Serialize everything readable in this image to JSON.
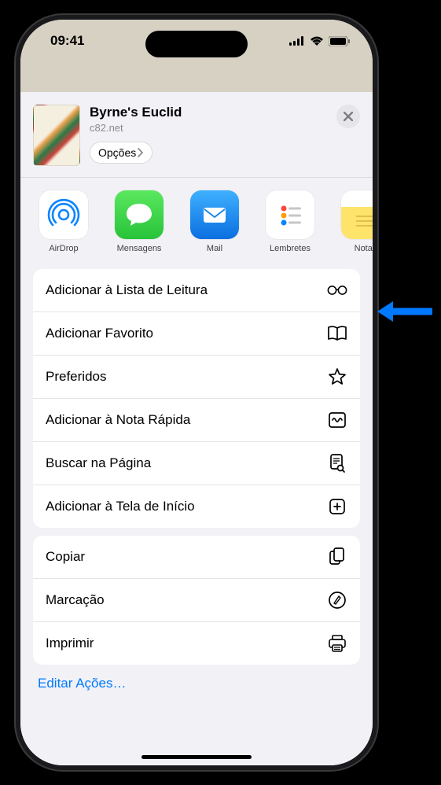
{
  "status": {
    "time": "09:41"
  },
  "header": {
    "title": "Byrne's Euclid",
    "subtitle": "c82.net",
    "options_label": "Opções"
  },
  "apps": [
    {
      "label": "AirDrop",
      "icon": "airdrop",
      "bg": "#ffffff",
      "fg": "#0a84ff"
    },
    {
      "label": "Mensagens",
      "icon": "messages",
      "bg": "#32d74b",
      "fg": "#ffffff"
    },
    {
      "label": "Mail",
      "icon": "mail",
      "bg": "#1e9bf0",
      "fg": "#ffffff"
    },
    {
      "label": "Lembretes",
      "icon": "reminders",
      "bg": "#ffffff",
      "fg": "#000000"
    },
    {
      "label": "Notas",
      "icon": "notes",
      "bg": "#ffe46b",
      "fg": "#8a6a00"
    }
  ],
  "group1": [
    {
      "label": "Adicionar à Lista de Leitura",
      "icon": "glasses"
    },
    {
      "label": "Adicionar Favorito",
      "icon": "book-open"
    },
    {
      "label": "Preferidos",
      "icon": "star"
    },
    {
      "label": "Adicionar à Nota Rápida",
      "icon": "quicknote"
    },
    {
      "label": "Buscar na Página",
      "icon": "doc-search"
    },
    {
      "label": "Adicionar à Tela de Início",
      "icon": "plus-square"
    }
  ],
  "group2": [
    {
      "label": "Copiar",
      "icon": "doc-on-doc"
    },
    {
      "label": "Marcação",
      "icon": "markup"
    },
    {
      "label": "Imprimir",
      "icon": "printer"
    }
  ],
  "edit_actions_label": "Editar Ações…"
}
